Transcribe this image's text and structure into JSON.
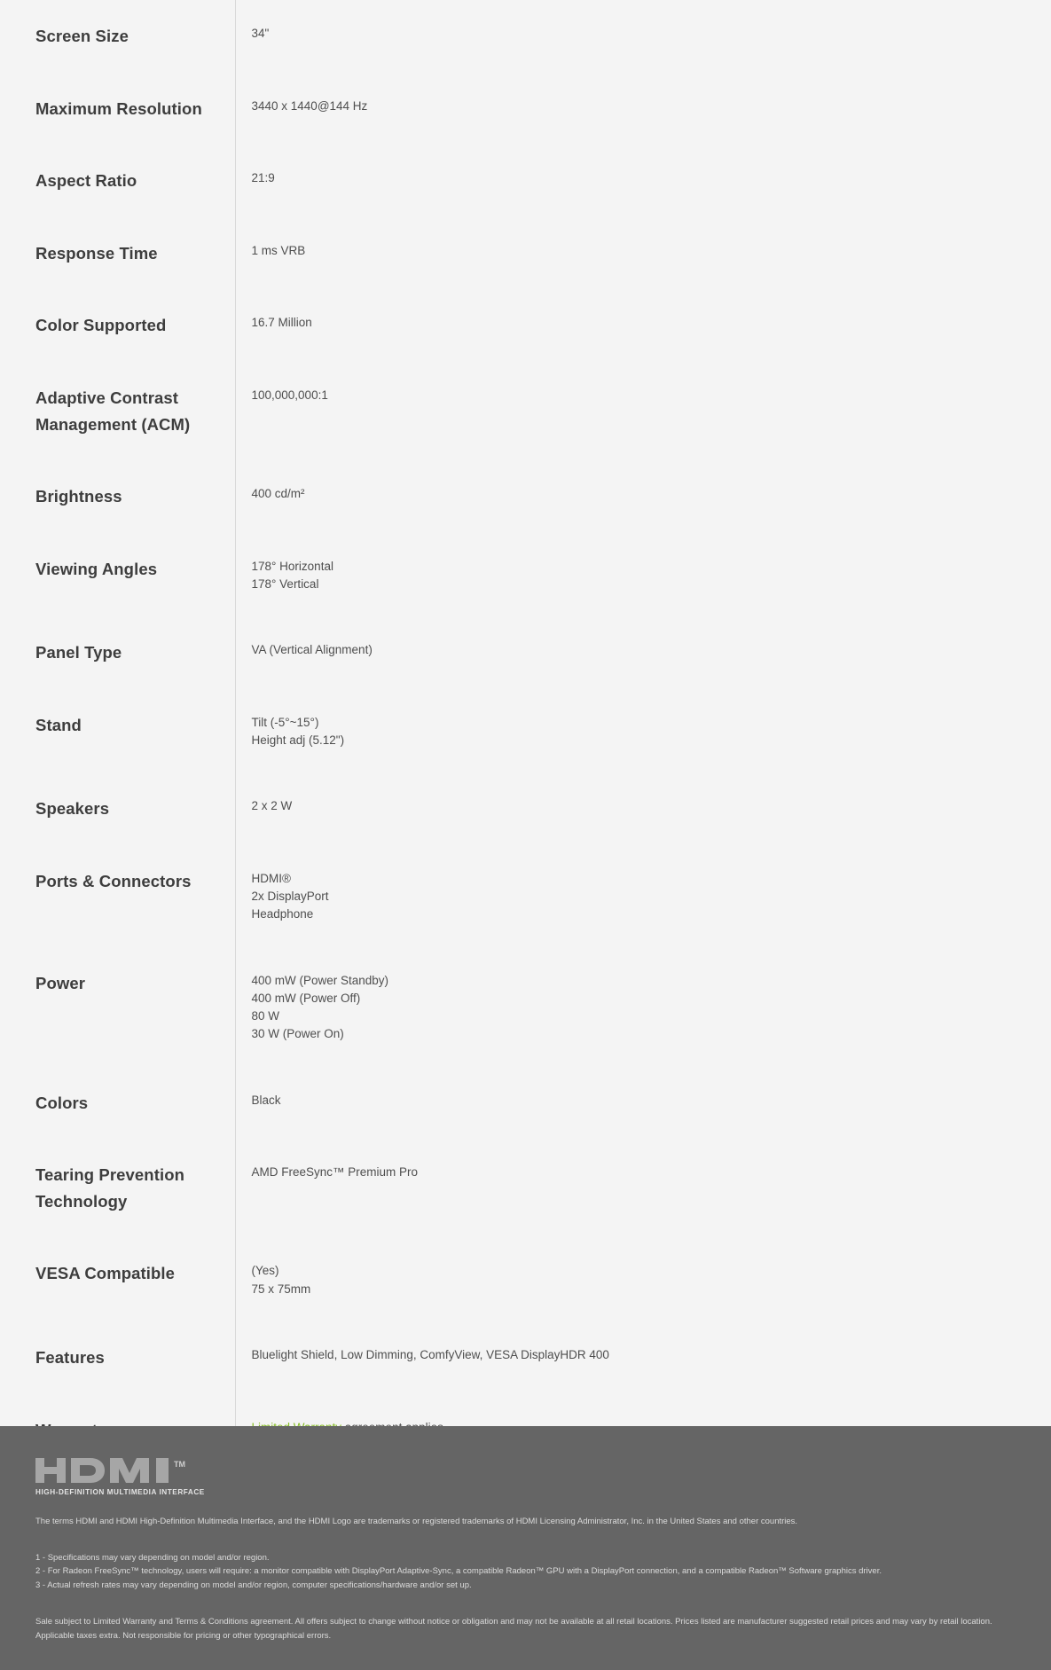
{
  "specs": {
    "rows": [
      {
        "label": "Screen Size",
        "values": [
          "34\""
        ]
      },
      {
        "label": "Maximum Resolution",
        "values": [
          "3440 x 1440@144 Hz"
        ]
      },
      {
        "label": "Aspect Ratio",
        "values": [
          "21:9"
        ]
      },
      {
        "label": "Response Time",
        "values": [
          "1 ms VRB"
        ]
      },
      {
        "label": "Color Supported",
        "values": [
          "16.7 Million"
        ]
      },
      {
        "label": "Adaptive Contrast Management (ACM)",
        "values": [
          "100,000,000:1"
        ]
      },
      {
        "label": "Brightness",
        "values": [
          "400 cd/m²"
        ]
      },
      {
        "label": "Viewing Angles",
        "values": [
          "178° Horizontal",
          "178° Vertical"
        ]
      },
      {
        "label": "Panel Type",
        "values": [
          "VA (Vertical Alignment)"
        ]
      },
      {
        "label": "Stand",
        "values": [
          "Tilt (-5°~15°)",
          "Height adj (5.12\")"
        ]
      },
      {
        "label": "Speakers",
        "values": [
          "2 x 2 W"
        ]
      },
      {
        "label": "Ports & Connectors",
        "values": [
          "HDMI®",
          "2x DisplayPort",
          "Headphone"
        ]
      },
      {
        "label": "Power",
        "values": [
          "400 mW (Power Standby)",
          "400 mW (Power Off)",
          "80 W",
          "30 W (Power On)"
        ]
      },
      {
        "label": "Colors",
        "values": [
          "Black"
        ]
      },
      {
        "label": "Tearing Prevention Technology",
        "values": [
          "AMD FreeSync™ Premium Pro"
        ]
      },
      {
        "label": "VESA Compatible",
        "values": [
          "(Yes)",
          "75 x 75mm"
        ]
      },
      {
        "label": "Features",
        "values": [
          "Bluelight Shield, Low Dimming, ComfyView, VESA DisplayHDR 400"
        ]
      }
    ],
    "warranty": {
      "label": "Warranty",
      "link_text": "Limited Warranty",
      "rest_text": " agreement applies.",
      "link_color": "#86bc25"
    }
  },
  "footer": {
    "hdmi_logo_text": "HDMI",
    "hdmi_trademark_symbol": "TM",
    "hdmi_subtitle": "HIGH-DEFINITION MULTIMEDIA INTERFACE",
    "hdmi_notice": "The terms HDMI and HDMI High-Definition Multimedia Interface, and the HDMI Logo are trademarks or registered trademarks of HDMI Licensing Administrator, Inc. in the United States and other countries.",
    "footnotes": [
      "1 - Specifications may vary depending on model and/or region.",
      "2 - For Radeon FreeSync™ technology, users will require: a monitor compatible with DisplayPort Adaptive-Sync, a compatible Radeon™ GPU with a DisplayPort connection, and a compatible Radeon™ Software graphics driver.",
      "3 - Actual refresh rates may vary depending on model and/or region, computer specifications/hardware and/or set up."
    ],
    "sale_note": "Sale subject to Limited Warranty and Terms & Conditions agreement. All offers subject to change without notice or obligation and may not be available at all retail locations. Prices listed are manufacturer suggested retail prices and may vary by retail location. Applicable taxes extra. Not responsible for pricing or other typographical errors.",
    "background_color": "#656565"
  }
}
